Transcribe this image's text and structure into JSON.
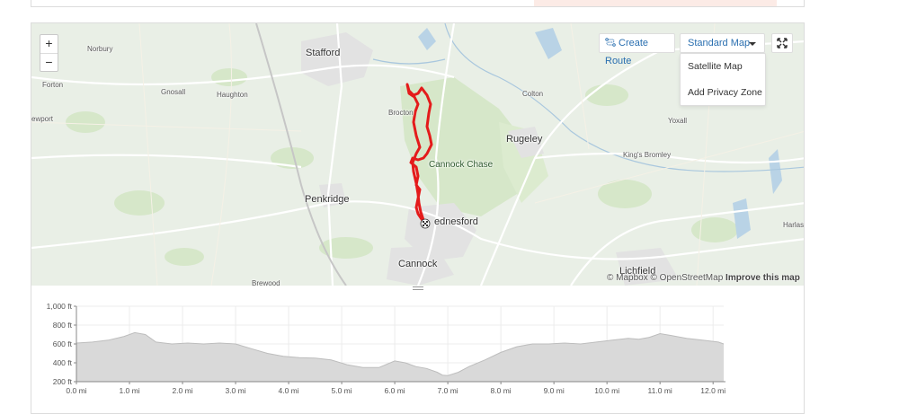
{
  "map": {
    "places": [
      {
        "name": "Norbury",
        "kind": "vil"
      },
      {
        "name": "Stafford",
        "kind": "town"
      },
      {
        "name": "Forton",
        "kind": "vil"
      },
      {
        "name": "Gnosall",
        "kind": "vil"
      },
      {
        "name": "Haughton",
        "kind": "vil"
      },
      {
        "name": "Colton",
        "kind": "vil"
      },
      {
        "name": "ewport",
        "kind": "vil"
      },
      {
        "name": "Brocton",
        "kind": "vil"
      },
      {
        "name": "Yoxall",
        "kind": "vil"
      },
      {
        "name": "Rugeley",
        "kind": "town"
      },
      {
        "name": "Cannock Chase",
        "kind": "park"
      },
      {
        "name": "King's Bromley",
        "kind": "vil"
      },
      {
        "name": "Penkridge",
        "kind": "town"
      },
      {
        "name": "ednesford",
        "kind": "town"
      },
      {
        "name": "Harlasto",
        "kind": "vil"
      },
      {
        "name": "Cannock",
        "kind": "town"
      },
      {
        "name": "Lichfield",
        "kind": "town"
      },
      {
        "name": "Brewood",
        "kind": "vil"
      }
    ],
    "zoom_in": "+",
    "zoom_out": "−",
    "create_route": "Create Route",
    "style_selected": "Standard Map",
    "style_options": [
      "Satellite Map",
      "Add Privacy Zone"
    ],
    "attribution_mapbox": "© Mapbox",
    "attribution_osm": "© OpenStreetMap",
    "attribution_improve": "Improve this map",
    "colors": {
      "route": "#e41b1b",
      "accent": "#2a6fb0",
      "park": "#cfe3c0",
      "land": "#e9efe6"
    }
  },
  "elevation": {
    "y_labels": [
      "1,000 ft",
      "800 ft",
      "600 ft",
      "400 ft",
      "200 ft"
    ],
    "x_labels": [
      "0.0 mi",
      "1.0 mi",
      "2.0 mi",
      "3.0 mi",
      "4.0 mi",
      "5.0 mi",
      "6.0 mi",
      "7.0 mi",
      "8.0 mi",
      "9.0 mi",
      "10.0 mi",
      "11.0 mi",
      "12.0 mi"
    ]
  },
  "chart_data": {
    "type": "area",
    "xlabel": "",
    "ylabel": "",
    "xlim": [
      0,
      12.2
    ],
    "ylim": [
      200,
      1000
    ],
    "x_unit": "mi",
    "y_unit": "ft",
    "x": [
      0,
      0.3,
      0.6,
      0.9,
      1.1,
      1.3,
      1.5,
      1.8,
      2.1,
      2.4,
      2.7,
      3.0,
      3.3,
      3.6,
      3.9,
      4.2,
      4.5,
      4.8,
      5.1,
      5.4,
      5.7,
      6.0,
      6.2,
      6.4,
      6.6,
      6.8,
      6.9,
      7.0,
      7.2,
      7.4,
      7.7,
      8.0,
      8.3,
      8.6,
      8.9,
      9.2,
      9.5,
      9.8,
      10.1,
      10.4,
      10.6,
      10.8,
      11.0,
      11.2,
      11.5,
      11.8,
      12.1,
      12.2
    ],
    "values": [
      610,
      620,
      640,
      680,
      720,
      700,
      620,
      600,
      610,
      600,
      610,
      600,
      550,
      500,
      470,
      455,
      450,
      430,
      380,
      350,
      350,
      420,
      400,
      360,
      340,
      300,
      270,
      265,
      300,
      360,
      430,
      510,
      570,
      600,
      600,
      610,
      600,
      620,
      640,
      660,
      650,
      670,
      710,
      690,
      660,
      640,
      620,
      600
    ],
    "grid": true
  }
}
